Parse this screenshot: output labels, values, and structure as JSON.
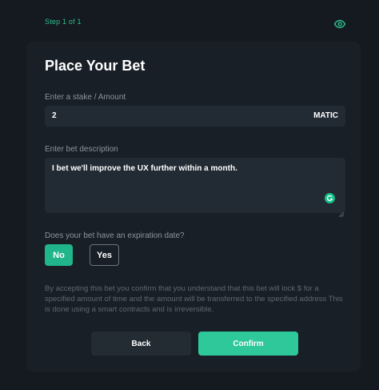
{
  "header": {
    "step_text": "Step 1 of 1",
    "visibility_icon": "eye-icon"
  },
  "form": {
    "title": "Place Your Bet",
    "amount": {
      "label": "Enter a stake / Amount",
      "value": "2",
      "unit": "MATIC"
    },
    "description": {
      "label": "Enter bet description",
      "value": "I bet we'll improve the UX further within a month.",
      "assistant_icon": "grammarly-icon"
    },
    "expiration": {
      "question": "Does your bet have an expiration date?",
      "options": [
        "No",
        "Yes"
      ],
      "selected": "No"
    },
    "disclaimer": "By accepting this bet you confirm that you understand that this bet will lock $ for a specified amount of time and the amount will be transferred to the specified address This is done using a smart contracts and is irreversible.",
    "back_label": "Back",
    "confirm_label": "Confirm"
  },
  "colors": {
    "background": "#141a1f",
    "card": "#181f26",
    "field": "#222b33",
    "accent": "#2ec89a",
    "step_text": "#2fbf8f"
  }
}
